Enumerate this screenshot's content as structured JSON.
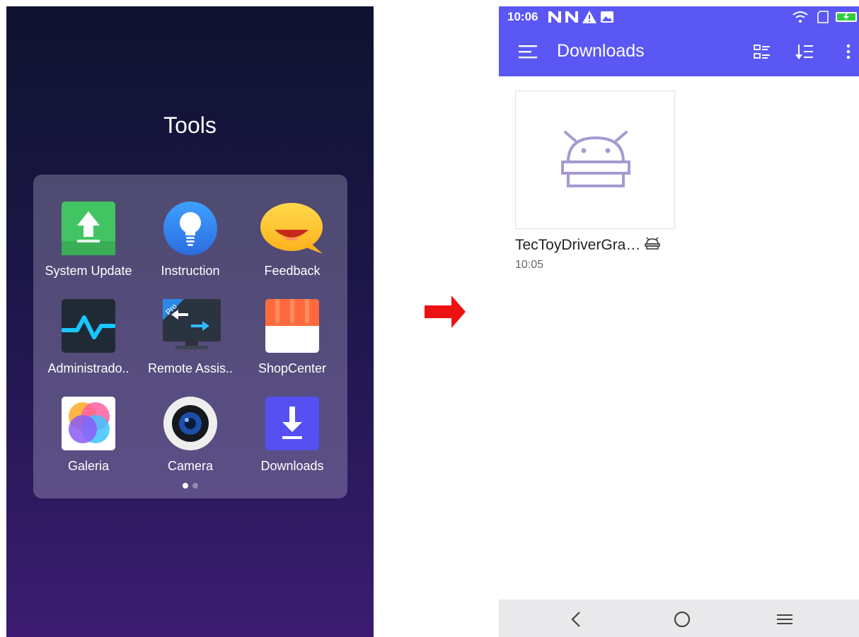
{
  "folder": {
    "title": "Tools",
    "apps": [
      {
        "label": "System Update",
        "icon": "system-update-icon"
      },
      {
        "label": "Instruction",
        "icon": "lightbulb-icon"
      },
      {
        "label": "Feedback",
        "icon": "feedback-icon"
      },
      {
        "label": "Administrado..",
        "icon": "pulse-icon"
      },
      {
        "label": "Remote Assis..",
        "icon": "remote-assist-icon"
      },
      {
        "label": "ShopCenter",
        "icon": "shop-icon"
      },
      {
        "label": "Galeria",
        "icon": "gallery-icon"
      },
      {
        "label": "Camera",
        "icon": "camera-icon"
      },
      {
        "label": "Downloads",
        "icon": "download-icon"
      }
    ],
    "page_count": 2,
    "current_page": 1
  },
  "downloads_app": {
    "status_time": "10:06",
    "title": "Downloads",
    "file": {
      "name": "TecToyDriverGra…",
      "time": "10:05",
      "type_icon": "android-icon"
    }
  },
  "colors": {
    "app_bar": "#5a57f5",
    "android_icon": "#a79ad0",
    "arrow": "#ee1111"
  }
}
